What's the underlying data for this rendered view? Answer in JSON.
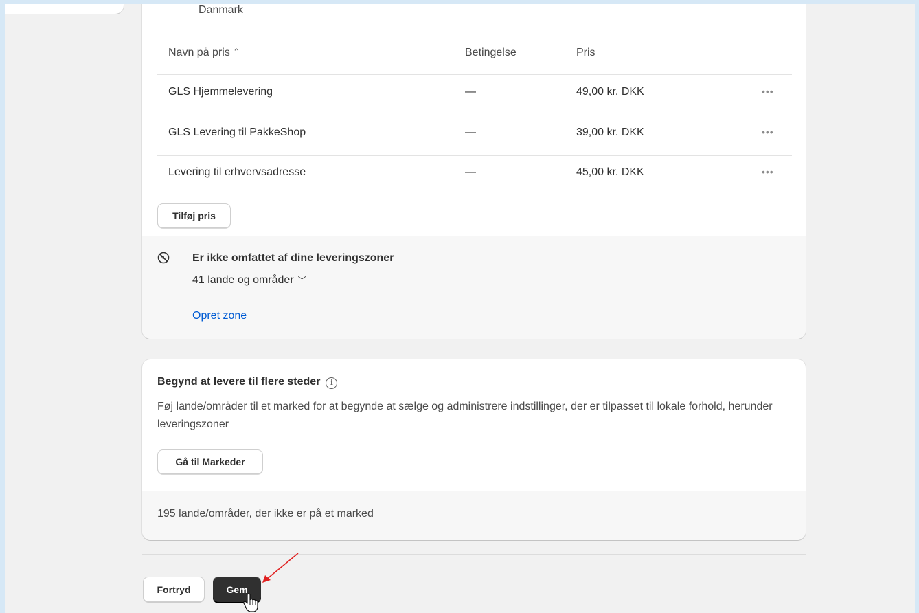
{
  "zone": {
    "country": "Danmark",
    "table": {
      "headers": {
        "name": "Navn på pris",
        "condition": "Betingelse",
        "price": "Pris"
      },
      "rows": [
        {
          "name": "GLS Hjemmelevering",
          "condition": "—",
          "price": "49,00 kr. DKK"
        },
        {
          "name": "GLS Levering til PakkeShop",
          "condition": "—",
          "price": "39,00 kr. DKK"
        },
        {
          "name": "Levering til erhvervsadresse",
          "condition": "—",
          "price": "45,00 kr. DKK"
        }
      ]
    },
    "add_price_label": "Tilføj pris"
  },
  "not_covered": {
    "title": "Er ikke omfattet af dine leveringszoner",
    "count": "41 lande og områder",
    "create_zone_link": "Opret zone"
  },
  "markets_card": {
    "title": "Begynd at levere til flere steder",
    "description": "Føj lande/områder til et marked for at begynde at sælge og administrere indstillinger, der er tilpasset til lokale forhold, herunder leveringszoner",
    "button_label": "Gå til Markeder",
    "footer_link": "195 lande/områder",
    "footer_rest": ", der ikke er på et marked"
  },
  "actions": {
    "cancel_label": "Fortryd",
    "save_label": "Gem"
  },
  "icons": {
    "more": "ellipsis-icon",
    "sort": "sort-icon",
    "globe": "globe-icon",
    "info": "info-icon",
    "chevron": "chevron-down-icon"
  },
  "colors": {
    "link": "#005bd3",
    "primary_button": "#303030",
    "annotation_arrow": "#e02020"
  }
}
